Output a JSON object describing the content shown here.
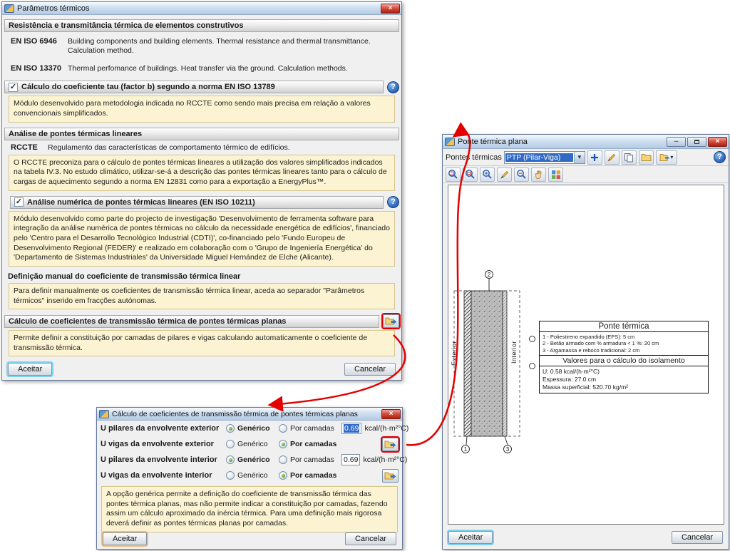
{
  "colors": {
    "accent_selection": "#316ac5",
    "annotation_red": "#e40000",
    "infobox_bg": "#fbf3d1",
    "titlebar_blue": "#b4cbe4"
  },
  "glyphs": {
    "close": "×",
    "minimize": "–",
    "help": "?",
    "check": "✓",
    "caret": "▾"
  },
  "window1": {
    "title": "Parâmetros térmicos",
    "section_resistance": "Resistência e transmitância térmica de elementos construtivos",
    "standards": [
      {
        "code": "EN ISO 6946",
        "text": "Building components and building elements. Thermal resistance and thermal transmittance. Calculation method."
      },
      {
        "code": "EN ISO 13370",
        "text": "Thermal perfomance of buildings. Heat transfer via the ground. Calculation methods."
      }
    ],
    "tau_label": "Cálculo do coeficiente tau (factor b) segundo a norma EN ISO 13789",
    "tau_info": "Módulo desenvolvido para metodologia indicada no RCCTE como sendo mais precisa em relação a valores convencionais simplificados.",
    "section_linear": "Análise de pontes térmicas lineares",
    "rccte_code": "RCCTE",
    "rccte_text": "Regulamento das características de comportamento térmico de edifícios.",
    "rccte_info": "O RCCTE preconiza para o cálculo de pontes térmicas lineares a utilização dos valores simplificados indicados na tabela IV.3. No estudo climático, utilizar-se-á a descrição das pontes térmicas lineares tanto para o cálculo de cargas de aquecimento segundo a norma EN 12831 como para a exportação a EnergyPlus™.",
    "numeric_label": "Análise numérica de pontes térmicas lineares (EN ISO 10211)",
    "numeric_info": "Módulo desenvolvido como parte do projecto de investigação 'Desenvolvimento de ferramenta software para integração da análise numérica de pontes térmicas no cálculo da necessidade energética de edifícios', financiado pelo 'Centro para el Desarrollo Tecnológico Industrial (CDTI)', co-financiado pelo 'Fundo Europeu de Desenvolvimento Regional (FEDER)' e realizado em colaboração com o 'Grupo de Ingeniería Energética' do 'Departamento de Sistemas Industriales' da Universidade Miguel Hernández de Elche (Alicante).",
    "manual_header": "Definição manual do coeficiente de transmissão térmica linear",
    "manual_info": "Para definir manualmente os coeficientes de transmissão térmica linear, aceda ao separador \"Parâmetros térmicos\" inserido em fracções autónomas.",
    "ptp_header": "Cálculo de coeficientes de transmissão térmica de pontes térmicas planas",
    "ptp_info": "Permite definir a constituição por camadas de pilares e vigas calculando automaticamente o coeficiente de transmissão térmica.",
    "accept": "Aceitar",
    "cancel": "Cancelar"
  },
  "window2": {
    "title": "Cálculo de coeficientes de transmissão térmica de pontes térmicas planas",
    "rows": [
      {
        "label": "U pilares da envolvente exterior",
        "opt_generic": "Genérico",
        "opt_layers": "Por camadas",
        "value": "0.69",
        "unit": "kcal/(h·m²°C)"
      },
      {
        "label": "U vigas da envolvente exterior",
        "opt_generic": "Genérico",
        "opt_layers": "Por camadas"
      },
      {
        "label": "U pilares da envolvente interior",
        "opt_generic": "Genérico",
        "opt_layers": "Por camadas",
        "value": "0.69",
        "unit": "kcal/(h·m²°C)"
      },
      {
        "label": "U vigas da envolvente interior",
        "opt_generic": "Genérico",
        "opt_layers": "Por camadas"
      }
    ],
    "info": "A opção genérica permite a definição do coeficiente de transmissão térmica das pontes térmica planas, mas não permite indicar a constituição por camadas, fazendo assim um cálculo aproximado da inércia térmica. Para uma definição mais rigorosa deverá definir as pontes térmicas planas por camadas.",
    "accept": "Aceitar",
    "cancel": "Cancelar"
  },
  "window3": {
    "title": "Ponte térmica plana",
    "toolbar": {
      "label": "Pontes térmicas",
      "dropdown_value": "PTP (Pilar-Viga)",
      "icons_row1": [
        "add-icon",
        "edit-icon",
        "copy-icon",
        "open-folder-icon",
        "import-export-icon"
      ],
      "icons_row2": [
        "zoom-redraw-icon",
        "zoom-window-icon",
        "zoom-inout-icon",
        "measure-icon",
        "zoom-prev-icon",
        "pan-icon",
        "views-icon"
      ]
    },
    "drawing": {
      "exterior_label": "Exterior",
      "interior_label": "Interior",
      "markers": [
        "1",
        "2",
        "3"
      ],
      "table_title": "Ponte térmica",
      "layers": [
        "1 - Poliestireno expandido (EPS): 5 cm",
        "2 - Betão armado com % armadura < 1 %: 20 cm",
        "3 - Argamassa e reboco tradicional: 2 cm"
      ],
      "values_title": "Valores para o cálculo do isolamento",
      "values": [
        "U: 0.58 kcal/(h·m²°C)",
        "Espessura: 27.0 cm",
        "Massa superficial: 520.70 kg/m²"
      ]
    },
    "accept": "Aceitar",
    "cancel": "Cancelar"
  }
}
